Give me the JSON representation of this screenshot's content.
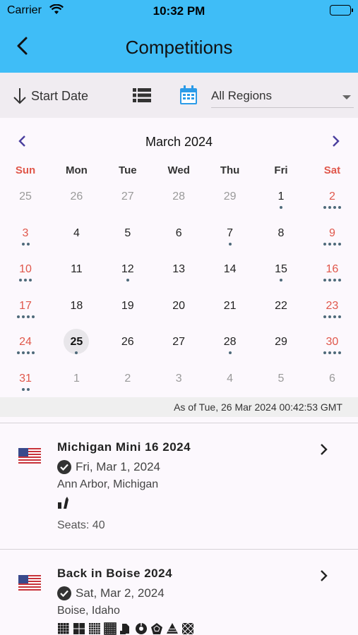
{
  "status": {
    "carrier": "Carrier",
    "time": "10:32 PM"
  },
  "header": {
    "title": "Competitions"
  },
  "filters": {
    "sort_label": "Start Date",
    "region": "All Regions"
  },
  "calendar": {
    "month": "March 2024",
    "weekdays": [
      "Sun",
      "Mon",
      "Tue",
      "Wed",
      "Thu",
      "Fri",
      "Sat"
    ],
    "weeks": [
      [
        {
          "d": "25",
          "o": true,
          "n": 0
        },
        {
          "d": "26",
          "o": true,
          "n": 0
        },
        {
          "d": "27",
          "o": true,
          "n": 0
        },
        {
          "d": "28",
          "o": true,
          "n": 0
        },
        {
          "d": "29",
          "o": true,
          "n": 0
        },
        {
          "d": "1",
          "o": false,
          "n": 1
        },
        {
          "d": "2",
          "o": false,
          "n": 4
        }
      ],
      [
        {
          "d": "3",
          "o": false,
          "n": 2
        },
        {
          "d": "4",
          "o": false,
          "n": 0
        },
        {
          "d": "5",
          "o": false,
          "n": 0
        },
        {
          "d": "6",
          "o": false,
          "n": 0
        },
        {
          "d": "7",
          "o": false,
          "n": 1
        },
        {
          "d": "8",
          "o": false,
          "n": 0
        },
        {
          "d": "9",
          "o": false,
          "n": 4
        }
      ],
      [
        {
          "d": "10",
          "o": false,
          "n": 3
        },
        {
          "d": "11",
          "o": false,
          "n": 0
        },
        {
          "d": "12",
          "o": false,
          "n": 1
        },
        {
          "d": "13",
          "o": false,
          "n": 0
        },
        {
          "d": "14",
          "o": false,
          "n": 0
        },
        {
          "d": "15",
          "o": false,
          "n": 1
        },
        {
          "d": "16",
          "o": false,
          "n": 4
        }
      ],
      [
        {
          "d": "17",
          "o": false,
          "n": 4
        },
        {
          "d": "18",
          "o": false,
          "n": 0
        },
        {
          "d": "19",
          "o": false,
          "n": 0
        },
        {
          "d": "20",
          "o": false,
          "n": 0
        },
        {
          "d": "21",
          "o": false,
          "n": 0
        },
        {
          "d": "22",
          "o": false,
          "n": 0
        },
        {
          "d": "23",
          "o": false,
          "n": 4
        }
      ],
      [
        {
          "d": "24",
          "o": false,
          "n": 4
        },
        {
          "d": "25",
          "o": false,
          "n": 1,
          "today": true
        },
        {
          "d": "26",
          "o": false,
          "n": 0
        },
        {
          "d": "27",
          "o": false,
          "n": 0
        },
        {
          "d": "28",
          "o": false,
          "n": 1
        },
        {
          "d": "29",
          "o": false,
          "n": 0
        },
        {
          "d": "30",
          "o": false,
          "n": 4
        }
      ],
      [
        {
          "d": "31",
          "o": false,
          "n": 2
        },
        {
          "d": "1",
          "o": true,
          "n": 0
        },
        {
          "d": "2",
          "o": true,
          "n": 0
        },
        {
          "d": "3",
          "o": true,
          "n": 0
        },
        {
          "d": "4",
          "o": true,
          "n": 0
        },
        {
          "d": "5",
          "o": true,
          "n": 0
        },
        {
          "d": "6",
          "o": true,
          "n": 0
        }
      ]
    ],
    "as_of": "As of Tue, 26 Mar 2024 00:42:53 GMT"
  },
  "competitions": [
    {
      "name": "Michigan Mini 16 2024",
      "date": "Fri, Mar 1, 2024",
      "location": "Ann Arbor, Michigan",
      "flag": "us-flag-icon",
      "events": [
        "fmc-icon"
      ],
      "seats": "Seats: 40"
    },
    {
      "name": "Back in Boise 2024",
      "date": "Sat, Mar 2, 2024",
      "location": "Boise, Idaho",
      "flag": "us-flag-icon",
      "events": [
        "4x4-icon",
        "2x2-icon",
        "5x5-icon",
        "6x6-icon",
        "bld-icon",
        "clock-icon",
        "megaminx-icon",
        "pyraminx-icon",
        "skewb-icon"
      ]
    }
  ],
  "colors": {
    "accent": "#3fbdf7",
    "weekend": "#e0574b",
    "dot": "#4e6a7a",
    "calendar_icon": "#2b9be8"
  }
}
